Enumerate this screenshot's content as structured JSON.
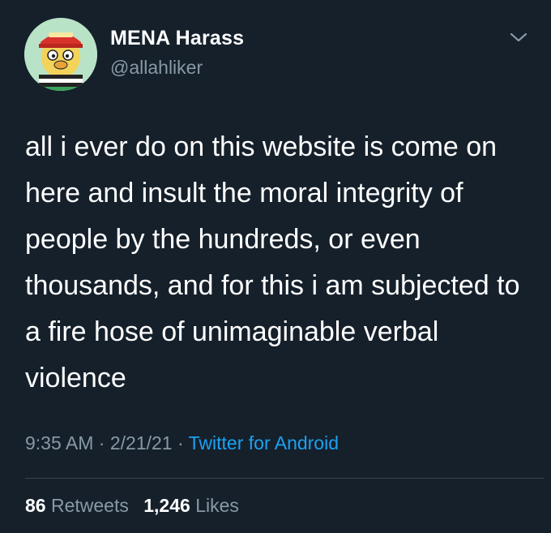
{
  "tweet": {
    "display_name": "MENA Harass",
    "handle": "@allahliker",
    "text": "all i ever do on this website is come on here and insult the moral integrity of people by the hundreds, or even thousands, and for this i am subjected to a fire hose of unimaginable verbal violence",
    "time": "9:35 AM",
    "date": "2/21/21",
    "separator": "·",
    "source": "Twitter for Android",
    "retweets": {
      "count": "86",
      "label": "Retweets"
    },
    "likes": {
      "count": "1,246",
      "label": "Likes"
    }
  },
  "icons": {
    "avatar": "cartoon-avatar-icon",
    "menu": "chevron-down-icon"
  },
  "colors": {
    "background": "#15202b",
    "primary_text": "#ffffff",
    "secondary_text": "#8899a6",
    "link": "#1da1f2",
    "divider": "#38444d"
  }
}
